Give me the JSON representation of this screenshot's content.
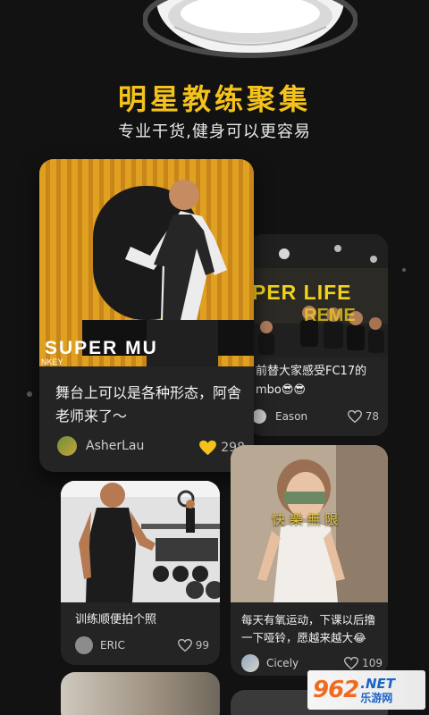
{
  "header": {
    "title": "明星教练聚集",
    "subtitle": "专业干货,健身可以更容易"
  },
  "colors": {
    "accent": "#F5C21B",
    "background": "#121212",
    "card": "#242424"
  },
  "posts": [
    {
      "caption": "舞台上可以是各种形态，阿舍老师来了～",
      "author": "AsherLau",
      "likes": "298",
      "liked": true,
      "photo_text": "SUPER MU",
      "photo_text_small": "NKEY"
    },
    {
      "caption": "前替大家感受FC17的mbo😎😎",
      "author": "Eason",
      "likes": "78",
      "liked": false,
      "photo_text_line1": "PER LIFE",
      "photo_text_line2": "REME"
    },
    {
      "caption": "训练顺便拍个照",
      "author": "ERIC",
      "likes": "99",
      "liked": false
    },
    {
      "caption": "每天有氧运动，下课以后撸一下哑铃，愿越来越大😂",
      "author": "Cicely",
      "likes": "109",
      "liked": false,
      "photo_text": "快 樂 無 限"
    }
  ],
  "watermark": {
    "number": "962",
    "suffix": ".NET",
    "sub": "乐游网"
  }
}
